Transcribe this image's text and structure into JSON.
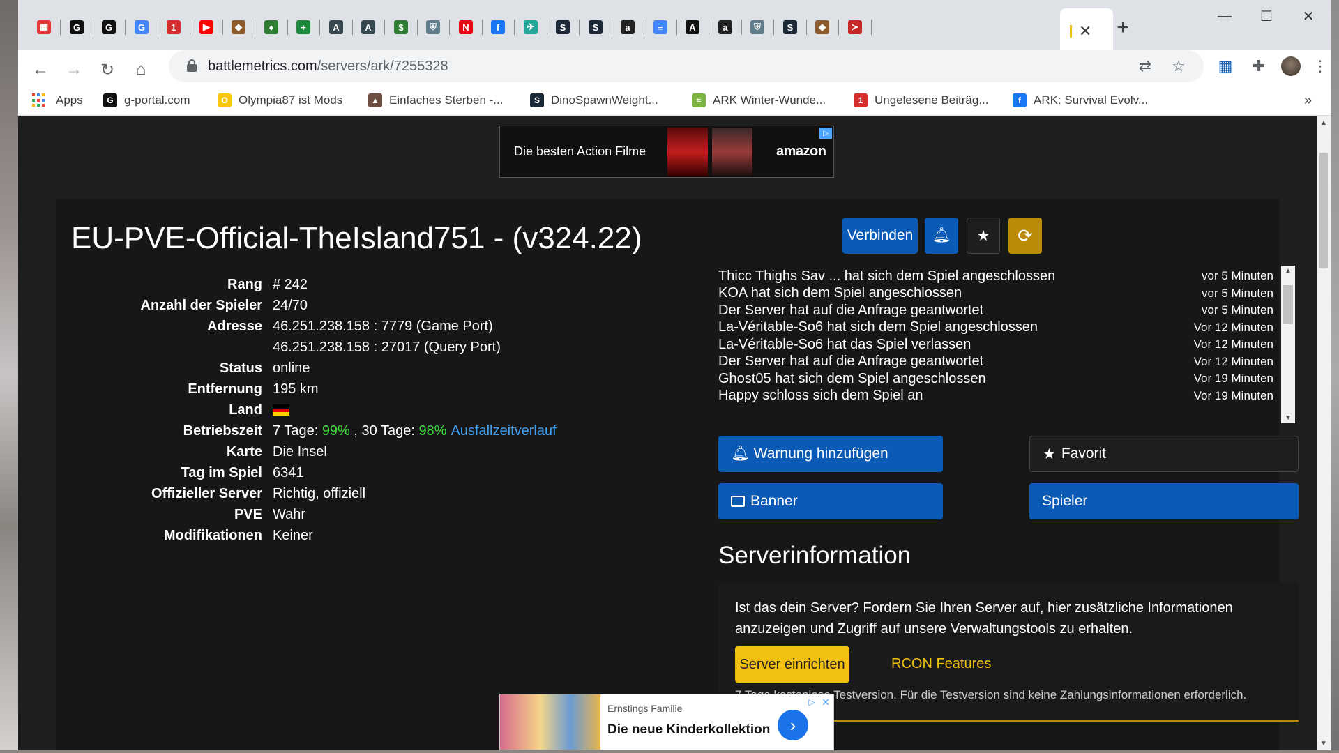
{
  "browser": {
    "url_domain": "battlemetrics.com",
    "url_path": "/servers/ark/7255328",
    "active_tab_close": "✕",
    "new_tab": "+",
    "window_controls": {
      "minimize": "—",
      "maximize": "☐",
      "close": "✕"
    },
    "tabs": [
      {
        "icon": "calendar-icon",
        "glyph": "▦",
        "color": "#e53935"
      },
      {
        "icon": "gportal-icon",
        "glyph": "G",
        "color": "#111"
      },
      {
        "icon": "gportal-icon",
        "glyph": "G",
        "color": "#111"
      },
      {
        "icon": "google-icon",
        "glyph": "G",
        "color": "#4285f4"
      },
      {
        "icon": "notification-icon",
        "glyph": "1",
        "color": "#d32f2f"
      },
      {
        "icon": "youtube-icon",
        "glyph": "▶",
        "color": "#ff0000"
      },
      {
        "icon": "dino-icon",
        "glyph": "◆",
        "color": "#8d5a2b"
      },
      {
        "icon": "gem-icon",
        "glyph": "♦",
        "color": "#2e7d32"
      },
      {
        "icon": "plus-icon",
        "glyph": "+",
        "color": "#1b8a3a"
      },
      {
        "icon": "ark-icon",
        "glyph": "A",
        "color": "#37474f"
      },
      {
        "icon": "ark-icon",
        "glyph": "A",
        "color": "#37474f"
      },
      {
        "icon": "money-icon",
        "glyph": "$",
        "color": "#2e7d32"
      },
      {
        "icon": "shield-icon",
        "glyph": "⛨",
        "color": "#607d8b"
      },
      {
        "icon": "netflix-icon",
        "glyph": "N",
        "color": "#e50914"
      },
      {
        "icon": "facebook-icon",
        "glyph": "f",
        "color": "#1877f2"
      },
      {
        "icon": "bird-icon",
        "glyph": "✈",
        "color": "#26a69a"
      },
      {
        "icon": "steam-icon",
        "glyph": "S",
        "color": "#1b2838"
      },
      {
        "icon": "steam-icon",
        "glyph": "S",
        "color": "#1b2838"
      },
      {
        "icon": "amazon-icon",
        "glyph": "a",
        "color": "#222"
      },
      {
        "icon": "docs-icon",
        "glyph": "≡",
        "color": "#4285f4"
      },
      {
        "icon": "a-logo-icon",
        "glyph": "A",
        "color": "#111"
      },
      {
        "icon": "amazon-icon",
        "glyph": "a",
        "color": "#222"
      },
      {
        "icon": "shield-icon",
        "glyph": "⛨",
        "color": "#607d8b"
      },
      {
        "icon": "steam-icon",
        "glyph": "S",
        "color": "#1b2838"
      },
      {
        "icon": "dino-icon",
        "glyph": "◆",
        "color": "#8d5a2b"
      },
      {
        "icon": "wing-icon",
        "glyph": "≻",
        "color": "#c62828"
      }
    ]
  },
  "bookmarks": [
    {
      "label": "Apps",
      "icon": "apps-grid-icon"
    },
    {
      "label": "g-portal.com",
      "icon": "gportal-icon",
      "glyph": "G",
      "color": "#111"
    },
    {
      "label": "Olympia87 ist Mods",
      "icon": "olympia-icon",
      "glyph": "O",
      "color": "#f9c80e"
    },
    {
      "label": "Einfaches Sterben -...",
      "icon": "triangle-icon",
      "glyph": "▲",
      "color": "#6d4c41"
    },
    {
      "label": "DinoSpawnWeight...",
      "icon": "steam-icon",
      "glyph": "S",
      "color": "#1b2838"
    },
    {
      "label": "ARK Winter-Wunde...",
      "icon": "bird-icon",
      "glyph": "≈",
      "color": "#7cb342"
    },
    {
      "label": "Ungelesene Beiträg...",
      "icon": "notification-icon",
      "glyph": "1",
      "color": "#d32f2f"
    },
    {
      "label": "ARK: Survival Evolv...",
      "icon": "facebook-icon",
      "glyph": "f",
      "color": "#1877f2"
    }
  ],
  "ad_top": {
    "text": "Die besten Action Filme",
    "brand": "amazon"
  },
  "server": {
    "title": "EU-PVE-Official-TheIsland751 - (v324.22)",
    "connect_label": "Verbinden",
    "rows": [
      {
        "label": "Rang",
        "value": "# 242"
      },
      {
        "label": "Anzahl der Spieler",
        "value": "24/70"
      },
      {
        "label": "Adresse",
        "value": "46.251.238.158 : 7779 (Game Port)"
      },
      {
        "label": "",
        "value": "46.251.238.158 : 27017 (Query Port)"
      },
      {
        "label": "Status",
        "value": "online"
      },
      {
        "label": "Entfernung",
        "value": "195 km"
      },
      {
        "label": "Land",
        "value": ""
      },
      {
        "label": "Betriebszeit",
        "value": ""
      },
      {
        "label": "Karte",
        "value": "Die Insel"
      },
      {
        "label": "Tag im Spiel",
        "value": "6341"
      },
      {
        "label": "Offizieller Server",
        "value": "Richtig, offiziell"
      },
      {
        "label": "PVE",
        "value": "Wahr"
      },
      {
        "label": "Modifikationen",
        "value": "Keiner"
      }
    ],
    "uptime": {
      "prefix7": "7 Tage: ",
      "pct7": "99%",
      "mid": " , 30 Tage: ",
      "pct30": "98%",
      "link": "Ausfallzeitverlauf"
    },
    "country_flag": {
      "colors": [
        "#000000",
        "#dd0000",
        "#ffce00"
      ]
    }
  },
  "activity": [
    {
      "msg": "Thicc Thighs Sav ... hat sich dem Spiel angeschlossen",
      "time": "vor 5 Minuten"
    },
    {
      "msg": "KOA hat sich dem Spiel angeschlossen",
      "time": "vor 5 Minuten"
    },
    {
      "msg": "Der Server hat auf die Anfrage geantwortet",
      "time": "vor 5 Minuten"
    },
    {
      "msg": "La-Véritable-So6 hat sich dem Spiel angeschlossen",
      "time": "Vor 12 Minuten"
    },
    {
      "msg": "La-Véritable-So6 hat das Spiel verlassen",
      "time": "Vor 12 Minuten"
    },
    {
      "msg": "Der Server hat auf die Anfrage geantwortet",
      "time": "Vor 12 Minuten"
    },
    {
      "msg": "Ghost05 hat sich dem Spiel angeschlossen",
      "time": "Vor 19 Minuten"
    },
    {
      "msg": "Happy schloss sich dem Spiel an",
      "time": "Vor 19 Minuten"
    }
  ],
  "actions": {
    "alert": "Warnung hinzufügen",
    "favorite": "Favorit",
    "banner": "Banner",
    "players": "Spieler"
  },
  "server_info": {
    "title": "Serverinformation",
    "claim_text": "Ist das dein Server? Fordern Sie Ihren Server auf, hier zusätzliche Informationen anzuzeigen und Zugriff auf unsere Verwaltungstools zu erhalten.",
    "claim_button": "Server einrichten",
    "rcon": "RCON Features",
    "trial": "7 Tage kostenlose Testversion. Für die Testversion sind keine Zahlungsinformationen erforderlich."
  },
  "ad_bottom": {
    "brand": "Ernstings Familie",
    "headline": "Die neue Kinderkollektion"
  },
  "colors": {
    "accent_blue": "#0a5ab6",
    "accent_gold": "#bb8b08",
    "claim_yellow": "#f2c011",
    "uptime_green": "#3ddb3d",
    "link_blue": "#3d9ff2"
  }
}
